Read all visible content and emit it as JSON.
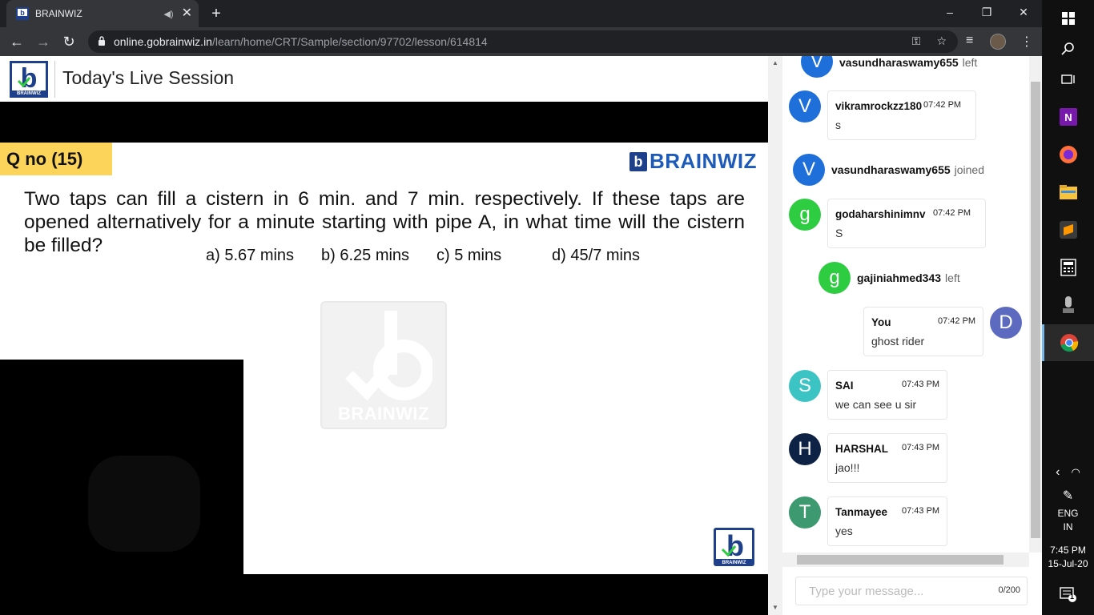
{
  "browser": {
    "tab_title": "BRAINWIZ",
    "tab_audio_icon": "speaker-icon",
    "tab_close": "✕",
    "new_tab": "+",
    "url_host": "online.gobrainwiz.in",
    "url_path": "/learn/home/CRT/Sample/section/97702/lesson/614814",
    "window_controls": {
      "minimize": "–",
      "maximize": "❐",
      "close": "✕"
    }
  },
  "header": {
    "logo_label": "BRAINWIZ",
    "title": "Today's Live Session"
  },
  "slide": {
    "qno": "Q no (15)",
    "brand": "BRAINWIZ",
    "brand_mark": "b",
    "question": "Two taps can fill a cistern in 6 min. and 7 min. respectively. If these taps are opened alternatively for a minute starting with pipe A, in what time will the cistern be filled?",
    "options": [
      "a) 5.67 mins",
      "b) 6.25 mins",
      "c) 5 mins",
      "d) 45/7 mins"
    ],
    "watermark_label": "BRAINWIZ",
    "mini_logo_label": "BRAINWIZ"
  },
  "chat": {
    "events": [
      {
        "initial": "V",
        "name": "vasundharaswamy655",
        "action": "left",
        "color": "#1e6fd9"
      },
      {
        "initial": "V",
        "name": "vasundharaswamy655",
        "action": "joined",
        "color": "#1e6fd9"
      },
      {
        "initial": "g",
        "name": "gajiniahmed343",
        "action": "left",
        "color": "#2ecc40"
      }
    ],
    "messages": [
      {
        "initial": "V",
        "name": "vikramrockzz180",
        "time": "07:42 PM",
        "text": "s",
        "color": "#1e6fd9"
      },
      {
        "initial": "g",
        "name": "godaharshinimnv",
        "time": "07:42 PM",
        "text": "S",
        "color": "#2ecc40"
      },
      {
        "initial": "D",
        "name": "You",
        "time": "07:42 PM",
        "text": "ghost rider",
        "color": "#5c6bc0"
      },
      {
        "initial": "S",
        "name": "SAI",
        "time": "07:43 PM",
        "text": "we can see u sir",
        "color": "#3cc3c3"
      },
      {
        "initial": "H",
        "name": "HARSHAL",
        "time": "07:43 PM",
        "text": "jao!!!",
        "color": "#0d2244"
      },
      {
        "initial": "T",
        "name": "Tanmayee",
        "time": "07:43 PM",
        "text": "yes",
        "color": "#3d9970"
      }
    ],
    "input_placeholder": "Type your message...",
    "char_count": "0/200"
  },
  "taskbar": {
    "lang_1": "ENG",
    "lang_2": "IN",
    "time": "7:45 PM",
    "date": "15-Jul-20",
    "notification_count": "1"
  }
}
